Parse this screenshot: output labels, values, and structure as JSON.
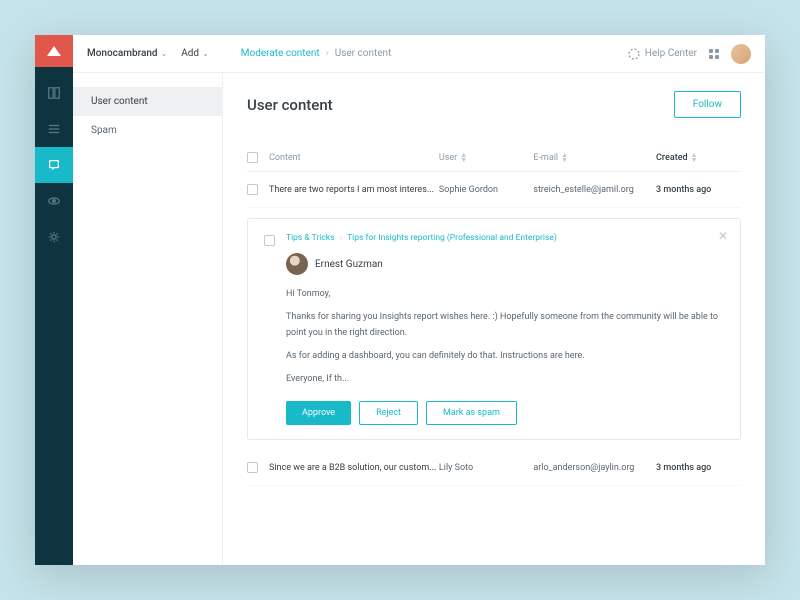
{
  "topbar": {
    "org": "Monocambrand",
    "add": "Add",
    "breadcrumb": {
      "root": "Moderate content",
      "current": "User content"
    },
    "help": "Help Center"
  },
  "sidebar": {
    "items": [
      {
        "label": "User content"
      },
      {
        "label": "Spam"
      }
    ]
  },
  "page": {
    "title": "User content",
    "follow": "Follow"
  },
  "table": {
    "headers": {
      "content": "Content",
      "user": "User",
      "email": "E-mail",
      "created": "Created"
    },
    "rows": [
      {
        "content": "There are two reports I am most interes...",
        "user": "Sophie Gordon",
        "email": "streich_estelle@jamil.org",
        "created": "3 months ago"
      },
      {
        "content": "Since we are a B2B solution, our custom...",
        "user": "Lily Soto",
        "email": "arlo_anderson@jaylin.org",
        "created": "3 months ago"
      }
    ]
  },
  "card": {
    "breadcrumb": {
      "a": "Tips & Tricks",
      "b": "Tips for Insights reporting (Professional and Enterprise)"
    },
    "user": "Ernest Guzman",
    "p1": "Hi Tonmoy,",
    "p2": "Thanks for sharing you Insights report wishes here. :) Hopefully someone from the community will be able to point you in the right direction.",
    "p3": "As for adding a dashboard, you can definitely do that. Instructions are here.",
    "p4": "Everyone, If th...",
    "actions": {
      "approve": "Approve",
      "reject": "Reject",
      "spam": "Mark as spam"
    }
  }
}
